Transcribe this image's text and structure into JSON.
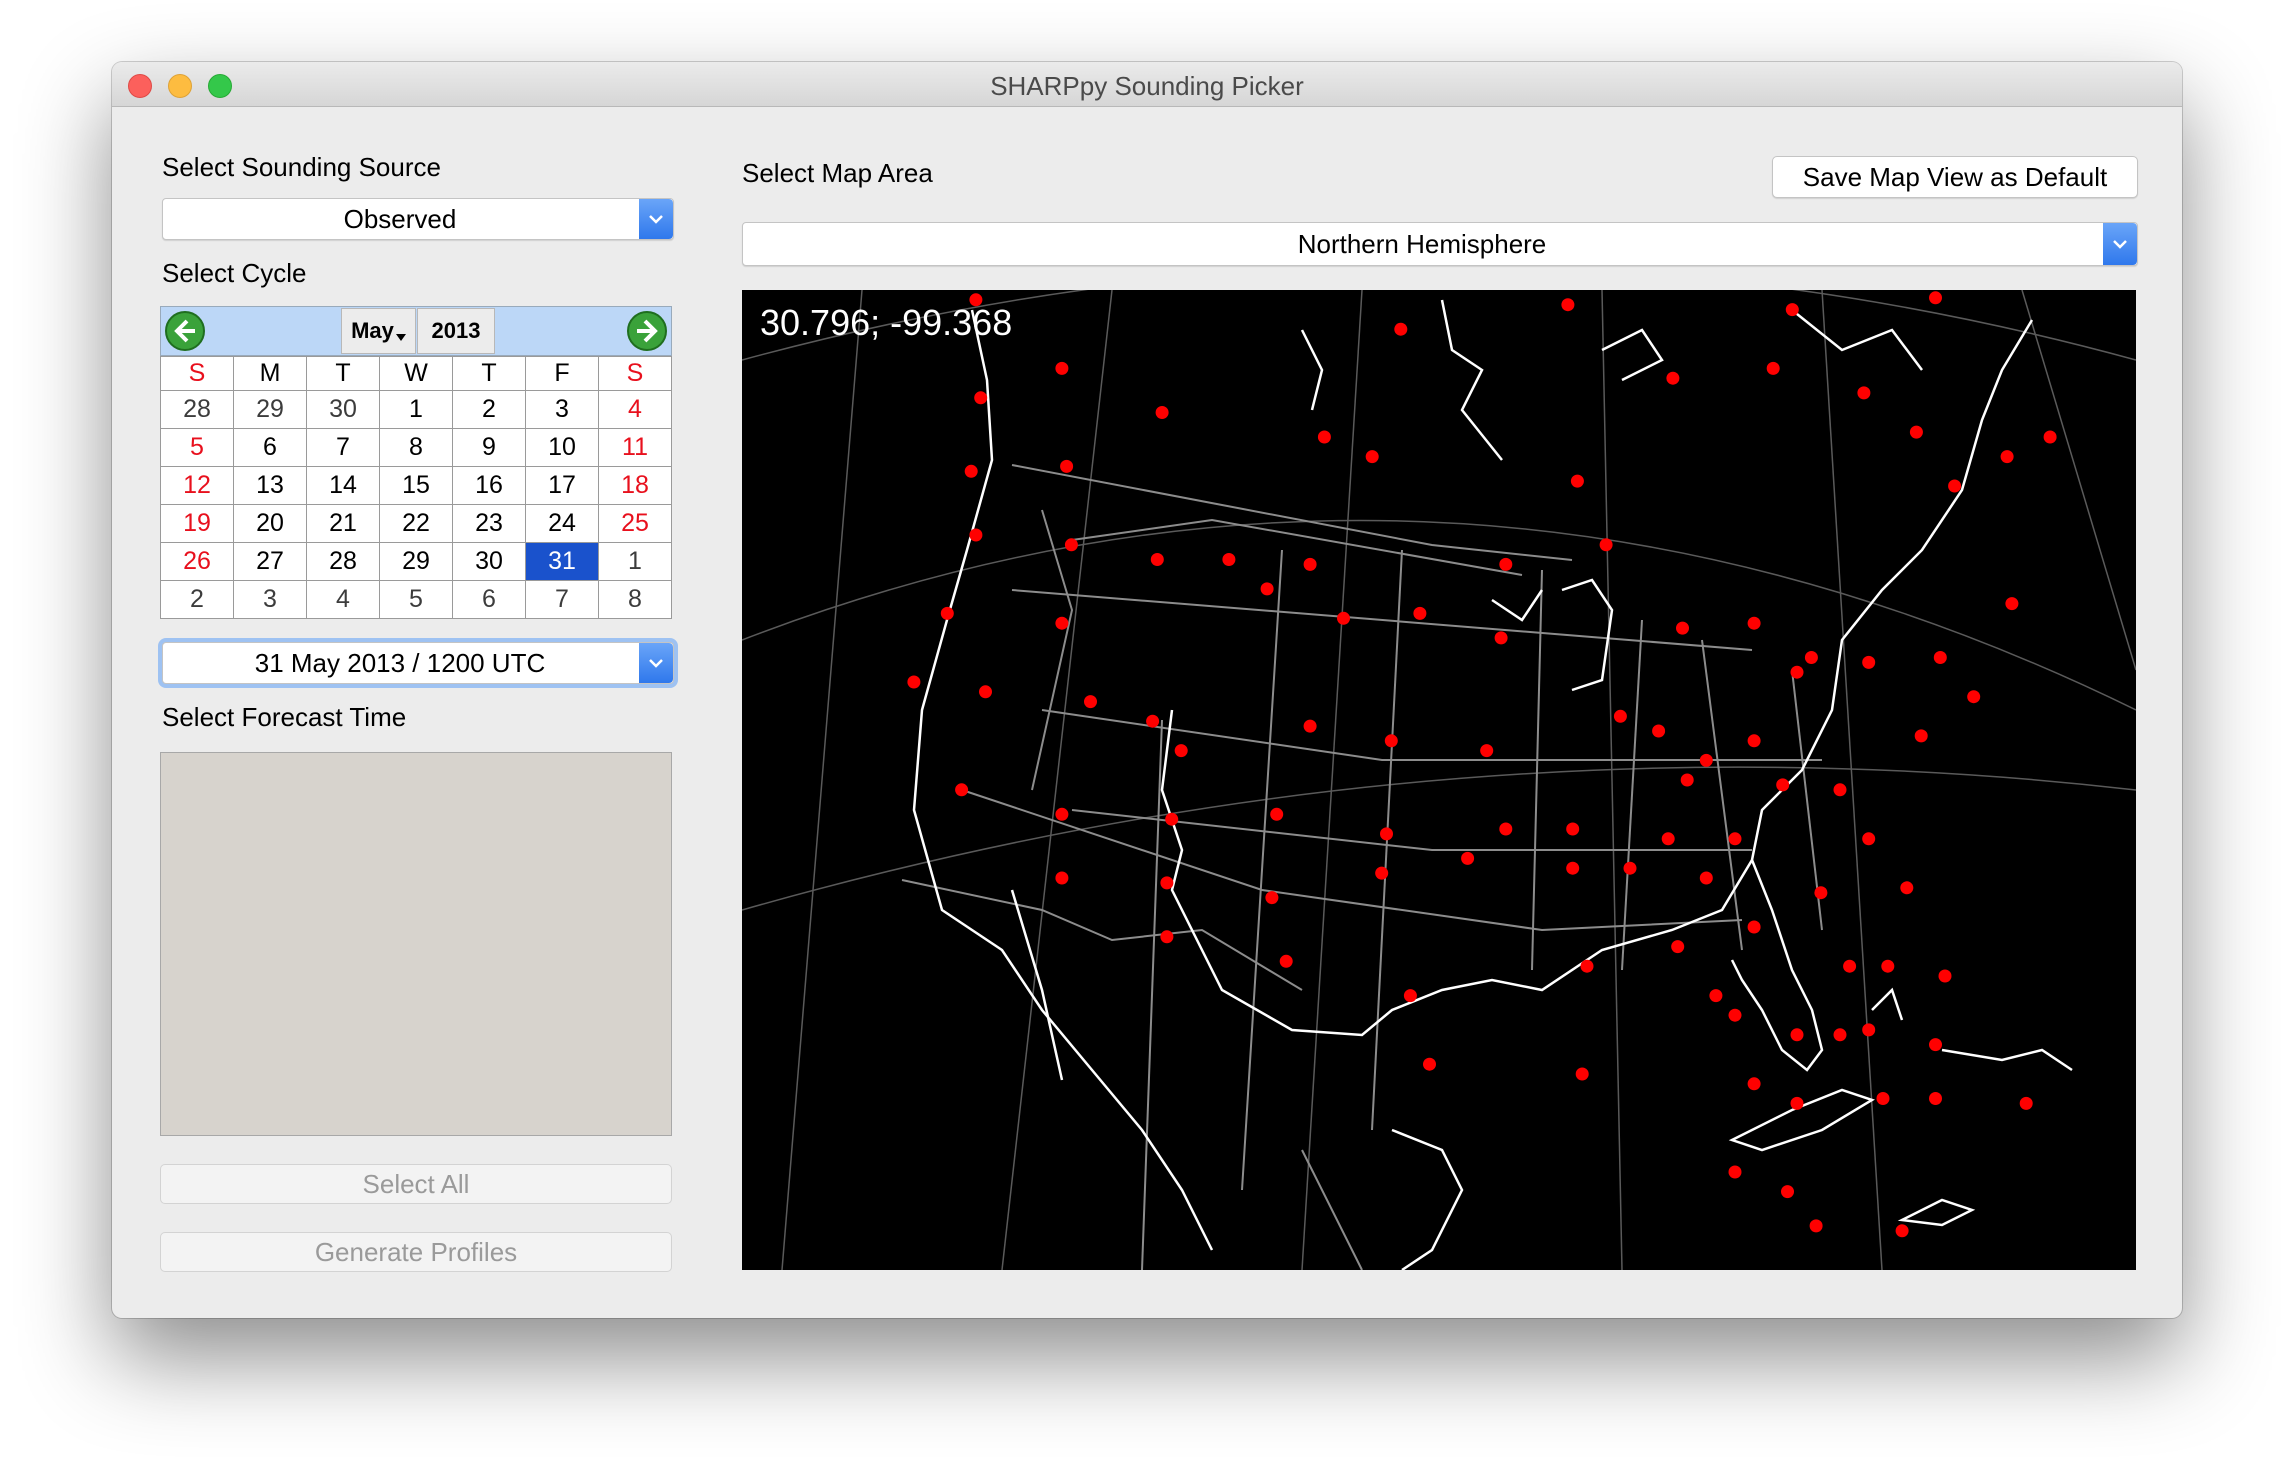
{
  "window": {
    "title": "SHARPpy Sounding Picker"
  },
  "source": {
    "label": "Select Sounding Source",
    "selected": "Observed"
  },
  "cycle": {
    "label": "Select Cycle",
    "month": "May",
    "year": "2013",
    "day_headers": [
      "S",
      "M",
      "T",
      "W",
      "T",
      "F",
      "S"
    ],
    "weeks": [
      [
        "28",
        "29",
        "30",
        "1",
        "2",
        "3",
        "4"
      ],
      [
        "5",
        "6",
        "7",
        "8",
        "9",
        "10",
        "11"
      ],
      [
        "12",
        "13",
        "14",
        "15",
        "16",
        "17",
        "18"
      ],
      [
        "19",
        "20",
        "21",
        "22",
        "23",
        "24",
        "25"
      ],
      [
        "26",
        "27",
        "28",
        "29",
        "30",
        "31",
        "1"
      ],
      [
        "2",
        "3",
        "4",
        "5",
        "6",
        "7",
        "8"
      ]
    ],
    "selected_day": "31",
    "selected_cycle": "31 May 2013 / 1200 UTC"
  },
  "forecast": {
    "label": "Select Forecast Time"
  },
  "buttons": {
    "select_all": "Select All",
    "generate": "Generate Profiles",
    "save_map": "Save Map View as Default"
  },
  "map": {
    "label": "Select Map Area",
    "selected_area": "Northern Hemisphere",
    "cursor_readout": "30.796; -99.368",
    "station_color": "#ff0000",
    "coastline_color": "#ffffff",
    "border_color": "#8c8c8c"
  },
  "colors": {
    "weekend": "#e8101d",
    "selection": "#1a52cc",
    "accent": "#2f78ec"
  }
}
